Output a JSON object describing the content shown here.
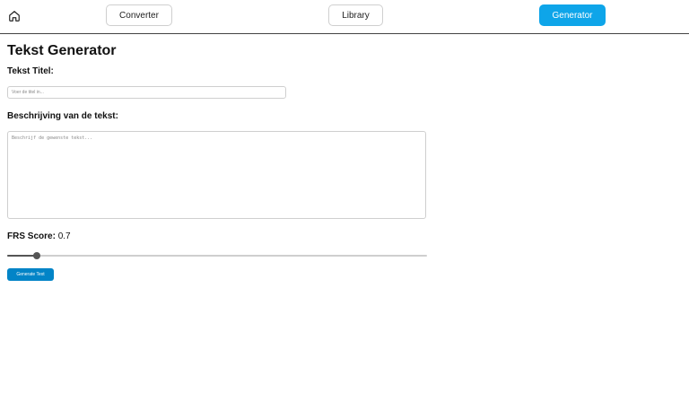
{
  "nav": {
    "home_icon": "home-icon",
    "converter_label": "Converter",
    "library_label": "Library",
    "generator_label": "Generator",
    "active_tab": "Generator",
    "accent": "#0ea5e9"
  },
  "main": {
    "title": "Tekst Generator",
    "title_label": "Tekst Titel:",
    "title_placeholder": "Voer de titel in...",
    "description_label": "Beschrijving van de tekst:",
    "description_placeholder": "Beschrijf de gewenste tekst...",
    "frs_label": "FRS Score:",
    "frs_value": "0.7",
    "frs_slider_fraction": 0.07,
    "generate_label": "Generate Text",
    "button_color": "#0284c7"
  }
}
